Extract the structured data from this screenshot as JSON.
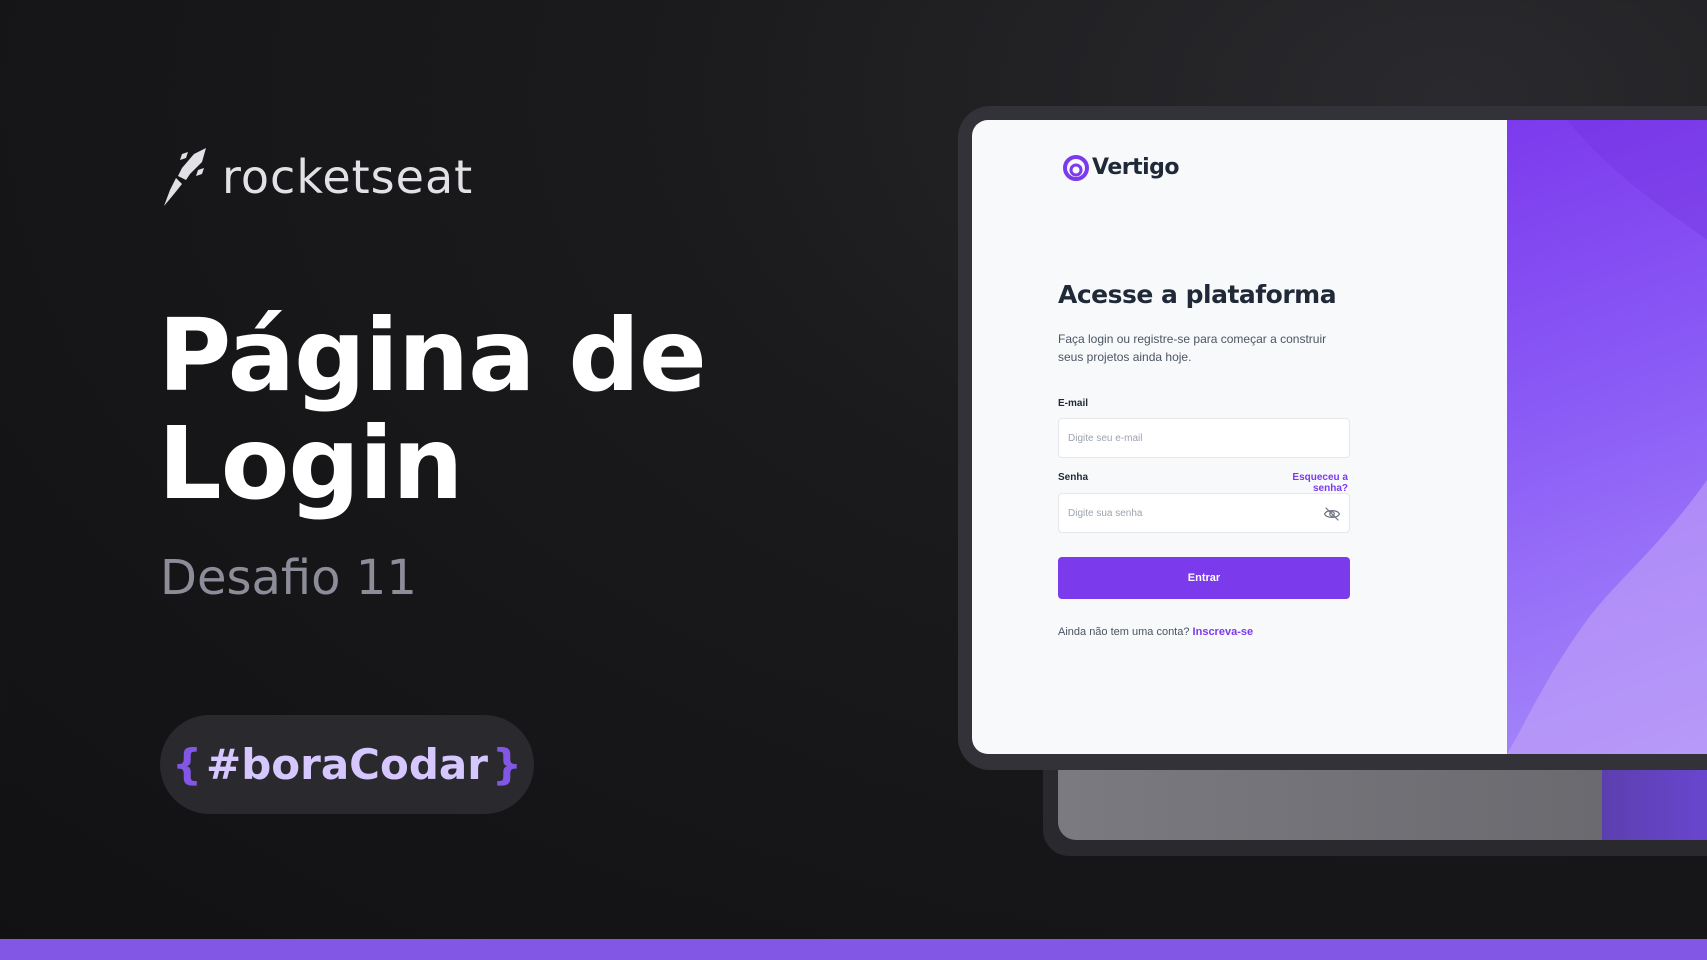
{
  "brand": {
    "name": "rocketseat",
    "icon": "rocket-icon"
  },
  "hero": {
    "title_line1": "Página de",
    "title_line2": "Login",
    "subtitle": "Desafio 11"
  },
  "tag": {
    "open": "{",
    "text": "#boraCodar",
    "close": "}"
  },
  "mockup": {
    "logo": {
      "name": "Vertigo",
      "icon": "vertigo-logo-icon"
    },
    "title": "Acesse a plataforma",
    "description": "Faça login ou registre-se para começar a construir seus projetos ainda hoje.",
    "email": {
      "label": "E-mail",
      "placeholder": "Digite seu e-mail"
    },
    "password": {
      "label": "Senha",
      "placeholder": "Digite sua senha",
      "forgot": "Esqueceu a senha?",
      "toggle_icon": "eye-off-icon"
    },
    "submit_label": "Entrar",
    "signup_prompt": "Ainda não tem uma conta?",
    "signup_link": "Inscreva-se"
  },
  "colors": {
    "accent": "#8257e5",
    "primary": "#7c3aed",
    "background": "#121214"
  }
}
